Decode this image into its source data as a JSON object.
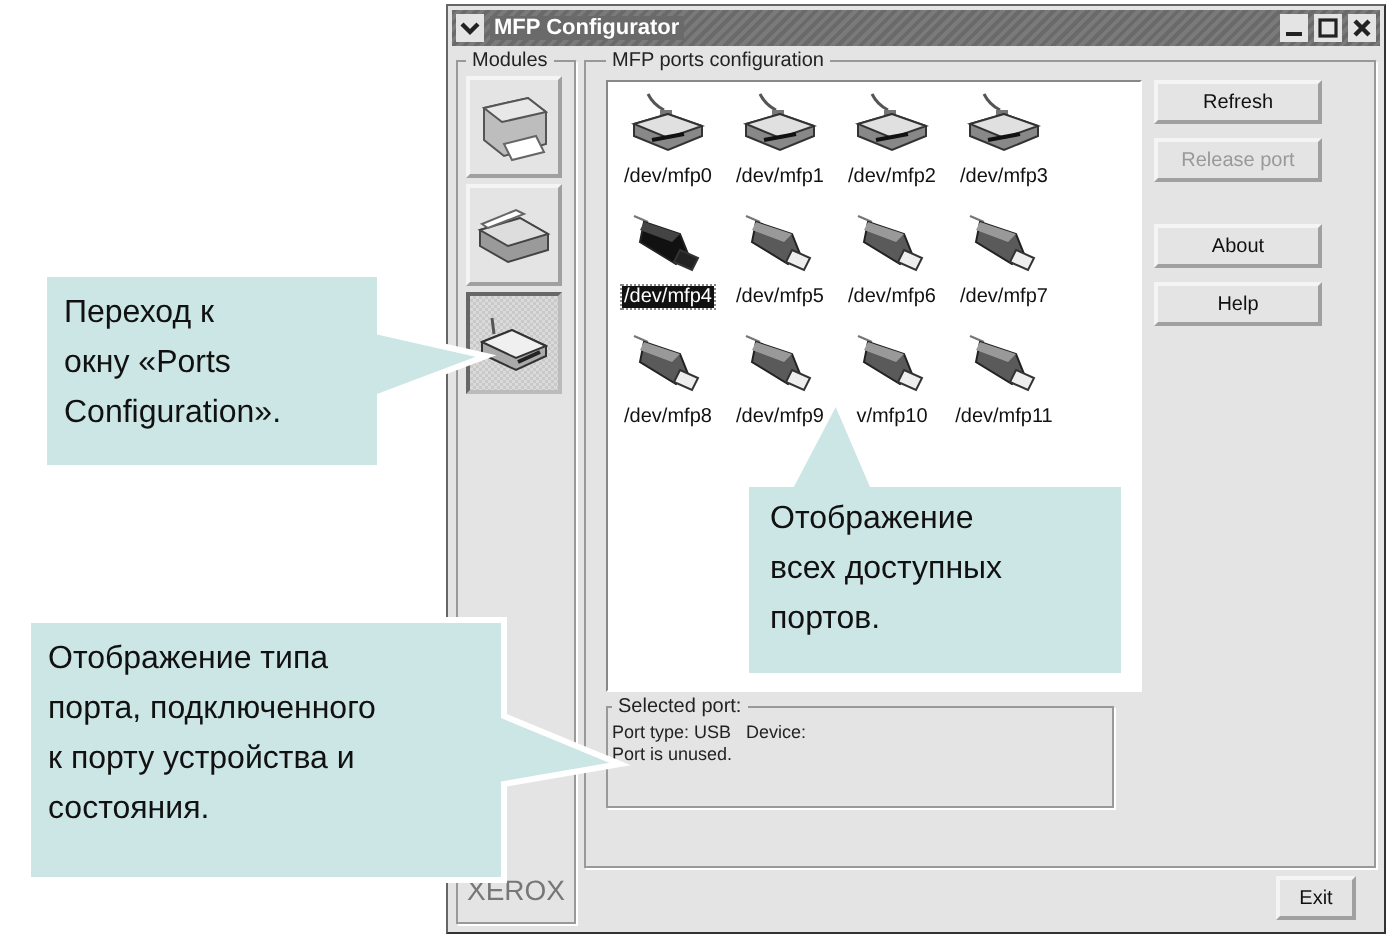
{
  "window": {
    "title": "MFP Configurator"
  },
  "modules": {
    "title": "Modules",
    "items": [
      {
        "kind": "printer",
        "selected": false
      },
      {
        "kind": "scanner",
        "selected": false
      },
      {
        "kind": "port",
        "selected": true
      }
    ]
  },
  "ports": {
    "title": "MFP ports configuration",
    "items": [
      {
        "label": "/dev/mfp0",
        "kind": "parallel",
        "selected": false
      },
      {
        "label": "/dev/mfp1",
        "kind": "parallel",
        "selected": false
      },
      {
        "label": "/dev/mfp2",
        "kind": "parallel",
        "selected": false
      },
      {
        "label": "/dev/mfp3",
        "kind": "parallel",
        "selected": false
      },
      {
        "label": "/dev/mfp4",
        "kind": "usb",
        "selected": true
      },
      {
        "label": "/dev/mfp5",
        "kind": "usb",
        "selected": false
      },
      {
        "label": "/dev/mfp6",
        "kind": "usb",
        "selected": false
      },
      {
        "label": "/dev/mfp7",
        "kind": "usb",
        "selected": false
      },
      {
        "label": "/dev/mfp8",
        "kind": "usb",
        "selected": false
      },
      {
        "label": "/dev/mfp9",
        "kind": "usb",
        "selected": false
      },
      {
        "label": "v/mfp10",
        "kind": "usb",
        "selected": false
      },
      {
        "label": "/dev/mfp11",
        "kind": "usb",
        "selected": false
      }
    ]
  },
  "buttons": [
    {
      "label": "Refresh",
      "disabled": false
    },
    {
      "label": "Release port",
      "disabled": true
    },
    {
      "label": "About",
      "disabled": false
    },
    {
      "label": "Help",
      "disabled": false
    }
  ],
  "selected_port": {
    "title": "Selected port:",
    "lines": [
      "Port type: USB   Device:",
      "Port is unused."
    ]
  },
  "logo": "XEROX",
  "exit": "Exit",
  "callouts": [
    {
      "lines": [
        "Переход к",
        "окну «Ports",
        "Configuration»."
      ]
    },
    {
      "lines": [
        "Отображение",
        "всех доступных",
        "портов."
      ]
    },
    {
      "lines": [
        "Отображение типа",
        "порта, подключенного",
        "к порту устройства и",
        "состояния."
      ]
    }
  ]
}
